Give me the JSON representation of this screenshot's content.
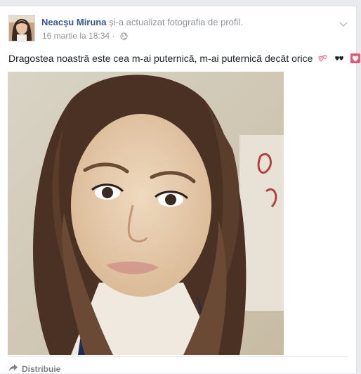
{
  "post": {
    "author": "Neacșu Miruna",
    "action": "și-a actualizat fotografia de profil.",
    "date": "16 martie la 18:34",
    "separator": "·",
    "audience_icon": "globe-icon",
    "text": "Dragostea noastră este cea m-ai puternică, m-ai puternică decât orice",
    "emoji_icons": [
      "revolving-hearts-icon",
      "black-hearts-icon",
      "heart-box-icon"
    ]
  },
  "actions": {
    "share_label": "Distribuie",
    "share_icon": "share-arrow-icon"
  },
  "colors": {
    "author_link": "#365899",
    "meta_gray": "#90949c",
    "body_text": "#1d2129",
    "background": "#e9ebee"
  }
}
